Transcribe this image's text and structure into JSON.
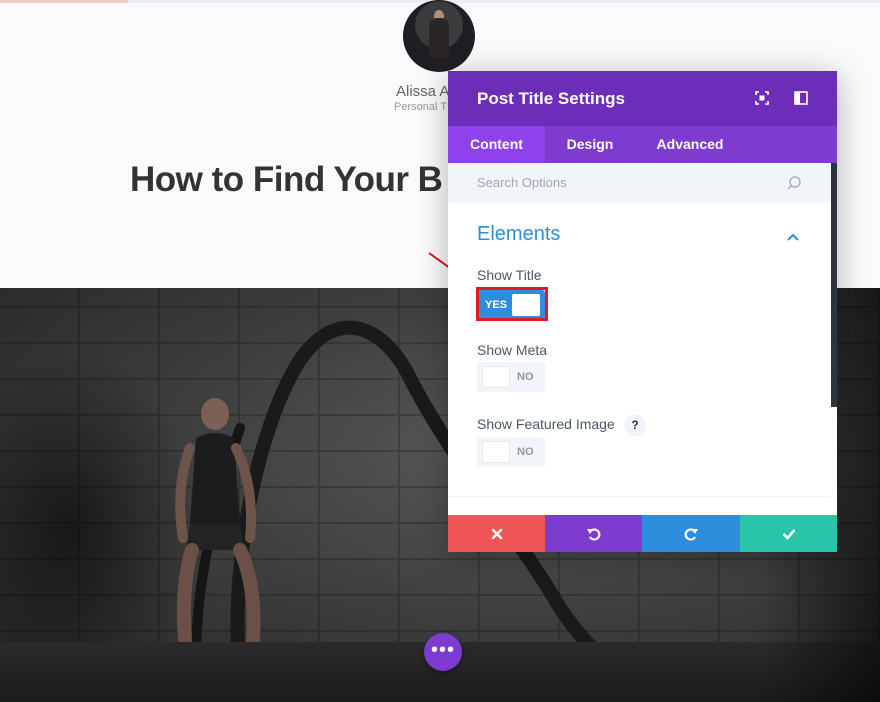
{
  "page": {
    "author_name": "Alissa A",
    "author_role": "Personal T",
    "post_title": "How to Find Your B"
  },
  "modal": {
    "title": "Post Title Settings",
    "tabs": [
      {
        "label": "Content",
        "active": true
      },
      {
        "label": "Design",
        "active": false
      },
      {
        "label": "Advanced",
        "active": false
      }
    ],
    "search": {
      "placeholder": "Search Options"
    },
    "section_title": "Elements",
    "options": [
      {
        "label": "Show Title",
        "state": "YES",
        "on": true,
        "highlighted": true
      },
      {
        "label": "Show Meta",
        "state": "NO",
        "on": false
      },
      {
        "label": "Show Featured Image",
        "state": "NO",
        "on": false,
        "help": "?"
      }
    ],
    "footer_buttons": [
      "close-icon",
      "undo-icon",
      "redo-icon",
      "check-icon"
    ]
  },
  "colors": {
    "header": "#6c2eb9",
    "tabs": "#7e3bd0",
    "active_tab": "#8f42ec",
    "accent_blue": "#2e8ede",
    "cancel": "#ef5555",
    "save": "#29c4a9",
    "highlight": "#e01a22"
  },
  "dots_button": "•••"
}
